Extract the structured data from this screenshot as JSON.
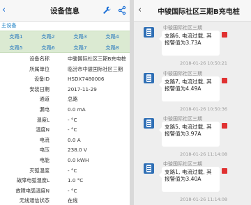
{
  "left": {
    "title": "设备信息",
    "main_device": "主设备",
    "tabs": [
      "支路1",
      "支路2",
      "支路3",
      "支路4",
      "支路5",
      "支路6",
      "支路7",
      "支路8"
    ],
    "rows": [
      {
        "label": "设备名称",
        "value": "中骏国际社区三期B充电桩"
      },
      {
        "label": "所属单位",
        "value": "临汾市中骏国际社区三期"
      },
      {
        "label": "设备ID",
        "value": "HSDX7480006"
      },
      {
        "label": "安装日期",
        "value": "2017-11-29"
      },
      {
        "label": "通道",
        "value": "总路"
      },
      {
        "label": "漏电",
        "value": "0.0 mA"
      },
      {
        "label": "温度L",
        "value": "- °C"
      },
      {
        "label": "温度N",
        "value": "- °C"
      },
      {
        "label": "电流",
        "value": "0.0 A"
      },
      {
        "label": "电压",
        "value": "238.0 V"
      },
      {
        "label": "电能",
        "value": "0.0 kWH"
      },
      {
        "label": "灭弧温度",
        "value": "- °C"
      },
      {
        "label": "故障电弧温度L",
        "value": "1.0 °C"
      },
      {
        "label": "故障电弧温度N",
        "value": "- °C"
      },
      {
        "label": "无线通信状态",
        "value": "在线"
      }
    ]
  },
  "right": {
    "title": "中骏国际社区三期B充电桩",
    "messages": [
      {
        "sender": "中骏国际社区三期",
        "text": "支路6, 电流过载, 其报警值为3.73A",
        "time": "2018-01-26 10:50:21"
      },
      {
        "sender": "中骏国际社区三期",
        "text": "支路7, 电流过载, 其报警值为4.49A",
        "time": "2018-01-26 10:50:36"
      },
      {
        "sender": "中骏国际社区三期",
        "text": "支路5, 电流过载, 其报警值为3.97A",
        "time": "2018-01-26 11:14:08"
      },
      {
        "sender": "中骏国际社区三期",
        "text": "支路1, 电流过载, 其报警值为3.40A",
        "time": "2018-01-26 11:14:08"
      }
    ]
  },
  "colors": {
    "link_blue": "#1a6fd6",
    "tab_bg": "#dbead2",
    "device_icon": "#2f6fb5",
    "alert_badge": "#e03131"
  },
  "icons": [
    "back-arrow-icon",
    "wrench-icon",
    "share-icon",
    "device-icon"
  ]
}
